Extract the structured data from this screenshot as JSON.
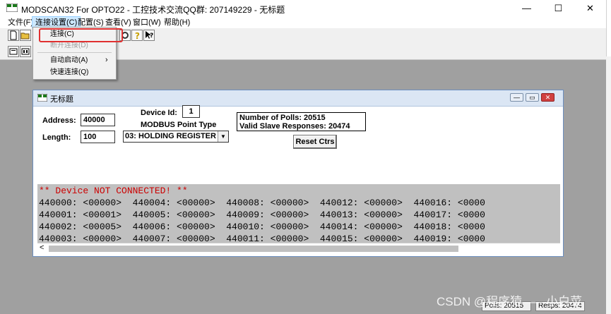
{
  "window": {
    "title": "MODSCAN32 For OPTO22 - 工控技术交流QQ群: 207149229 - 无标题",
    "min": "—",
    "max": "☐",
    "close": "✕"
  },
  "menu": [
    "文件(F)",
    "连接设置(C)",
    "配置(S)",
    "查看(V)",
    "窗口(W)",
    "帮助(H)"
  ],
  "dropdown": {
    "items": [
      {
        "label": "连接(C)"
      },
      {
        "label": "断开连接(D)"
      },
      {
        "label": "自动启动(A)"
      },
      {
        "label": "快速连接(Q)"
      }
    ],
    "submenu_arrow": "›"
  },
  "child": {
    "title": "无标题",
    "address_label": "Address:",
    "address_value": "40000",
    "length_label": "Length:",
    "length_value": "100",
    "device_id_label": "Device Id:",
    "device_id_value": "1",
    "point_type_label": "MODBUS Point Type",
    "point_type_value": "03: HOLDING REGISTER",
    "polls_text": "Number of Polls: 20515",
    "responses_text": "Valid Slave Responses: 20474",
    "reset_label": "Reset Ctrs",
    "not_connected": "** Device NOT CONNECTED! **",
    "rows": [
      "440000: <00000>  440004: <00000>  440008: <00000>  440012: <00000>  440016: <0000",
      "440001: <00001>  440005: <00000>  440009: <00000>  440013: <00000>  440017: <0000",
      "440002: <00005>  440006: <00000>  440010: <00000>  440014: <00000>  440018: <0000",
      "440003: <00000>  440007: <00000>  440011: <00000>  440015: <00000>  440019: <0000"
    ],
    "scroll_left": "<"
  },
  "status": {
    "polls": "Polls: 20515",
    "resps": "Resps: 20474"
  },
  "watermark": "CSDN @程序猿——小白菜",
  "colors": {
    "client_bg": "#a0a0a0",
    "menu_highlight": "#e03030",
    "error_text": "#cc0000"
  }
}
